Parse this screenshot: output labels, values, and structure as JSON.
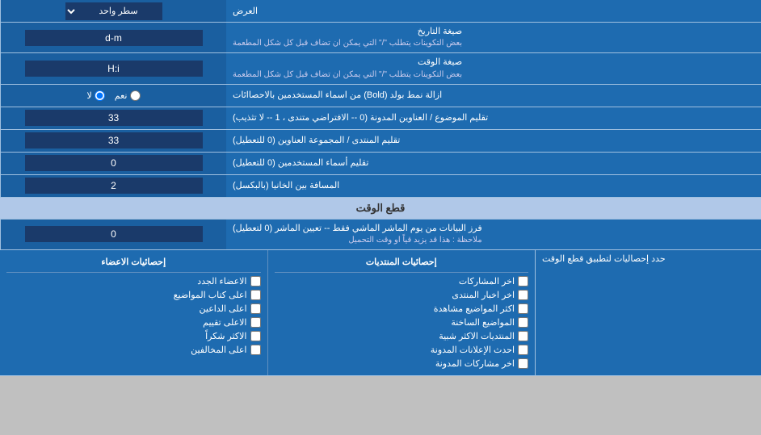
{
  "page": {
    "top_label": "العرض",
    "top_select_label": "سطر واحد",
    "date_format_label": "صيغة التاريخ",
    "date_format_note": "بعض التكوينات يتطلب \"/\" التي يمكن ان تضاف قبل كل شكل المطعمة",
    "date_format_value": "d-m",
    "time_format_label": "صيغة الوقت",
    "time_format_note": "بعض التكوينات يتطلب \"/\" التي يمكن ان تضاف قبل كل شكل المطعمة",
    "time_format_value": "H:i",
    "bold_label": "ازالة نمط بولد (Bold) من اسماء المستخدمين بالاحصاائات",
    "bold_yes": "نعم",
    "bold_no": "لا",
    "topics_label": "تقليم الموضوع / العناوين المدونة (0 -- الافتراضي متندى ، 1 -- لا تثذيب)",
    "topics_value": "33",
    "forum_label": "تقليم المنتدى / المجموعة العناوين (0 للتعطيل)",
    "forum_value": "33",
    "users_label": "تقليم أسماء المستخدمين (0 للتعطيل)",
    "users_value": "0",
    "distance_label": "المسافة بين الخانيا (بالبكسل)",
    "distance_value": "2",
    "cutoff_section": "قطع الوقت",
    "cutoff_label": "فرز البيانات من يوم الماشر الماشي فقط -- تعيين الماشر (0 لتعطيل)",
    "cutoff_note": "ملاحظة : هذا قد يزيد قياً او وقت التحميل",
    "cutoff_value": "0",
    "stats_apply_label": "حدد إحصاليات لتطبيق قطع الوقت",
    "stats_col1_header": "إحصائيات المنتديات",
    "stats_col2_header": "إحصائيات الاعضاء",
    "stats_col1_items": [
      "اخر المشاركات",
      "اخر اخبار المنتدى",
      "اكثر المواضيع مشاهدة",
      "المواضيع الساخنة",
      "المنتديات الاكثر شبية",
      "احدث الإعلانات المدونة",
      "اخر مشاركات المدونة"
    ],
    "stats_col2_items": [
      "الاعضاء الجدد",
      "اعلى كتاب المواضيع",
      "اعلى الداعين",
      "الاعلى تقييم",
      "الاكثر شكراً",
      "اعلى المخالفين"
    ]
  }
}
